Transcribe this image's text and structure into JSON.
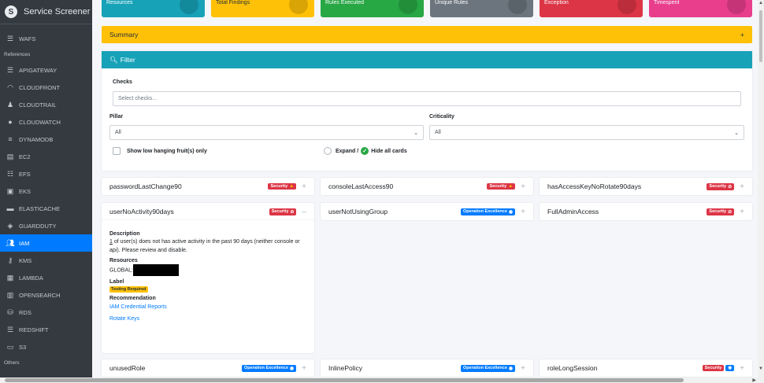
{
  "brand": {
    "name": "Service Screener"
  },
  "sidebar": {
    "top_items": [
      {
        "label": "WAFS",
        "icon": "list-icon"
      }
    ],
    "references_header": "References",
    "items": [
      {
        "label": "APIGATEWAY",
        "icon": "list-icon"
      },
      {
        "label": "CLOUDFRONT",
        "icon": "wifi-icon"
      },
      {
        "label": "CLOUDTRAIL",
        "icon": "user-secret-icon"
      },
      {
        "label": "CLOUDWATCH",
        "icon": "clock-icon"
      },
      {
        "label": "DYNAMODB",
        "icon": "bars-icon"
      },
      {
        "label": "EC2",
        "icon": "server-icon"
      },
      {
        "label": "EFS",
        "icon": "sitemap-icon"
      },
      {
        "label": "EKS",
        "icon": "briefcase-icon"
      },
      {
        "label": "ELASTICACHE",
        "icon": "memory-icon"
      },
      {
        "label": "GUARDDUTY",
        "icon": "shield-icon"
      },
      {
        "label": "IAM",
        "icon": "users-icon"
      },
      {
        "label": "KMS",
        "icon": "key-icon"
      },
      {
        "label": "LAMBDA",
        "icon": "calculator-icon"
      },
      {
        "label": "OPENSEARCH",
        "icon": "search-box-icon"
      },
      {
        "label": "RDS",
        "icon": "database-icon"
      },
      {
        "label": "REDSHIFT",
        "icon": "list-icon"
      },
      {
        "label": "S3",
        "icon": "hdd-icon"
      }
    ],
    "others_header": "Others",
    "active": "IAM"
  },
  "tiles": [
    {
      "label": "Resources",
      "color": "#17a2b8"
    },
    {
      "label": "Total Findings",
      "color": "#ffc107"
    },
    {
      "label": "Rules Executed",
      "color": "#28a745"
    },
    {
      "label": "Unique Rules",
      "color": "#6c757d"
    },
    {
      "label": "Exception",
      "color": "#dc3545"
    },
    {
      "label": "Timespent",
      "color": "#e83e8c"
    }
  ],
  "summary": {
    "title": "Summary",
    "toggle": "+"
  },
  "filter": {
    "title": "Filter",
    "checks_label": "Checks",
    "checks_placeholder": "Select checks...",
    "pillar_label": "Pillar",
    "pillar_value": "All",
    "criticality_label": "Criticality",
    "criticality_value": "All",
    "low_hanging_label": "Show low hanging fruit(s) only",
    "expand_label": "Expand /",
    "hide_label": "Hide all cards"
  },
  "cards": [
    {
      "name": "passwordLastChange90",
      "badge": "Security",
      "badge_type": "sec",
      "badge_icon": "warning-icon",
      "toggle": "+"
    },
    {
      "name": "consoleLastAccess90",
      "badge": "Security",
      "badge_type": "sec",
      "badge_icon": "warning-icon",
      "toggle": "+"
    },
    {
      "name": "hasAccessKeyNoRotate90days",
      "badge": "Security",
      "badge_type": "sec",
      "badge_icon": "ban-icon",
      "toggle": "+"
    },
    {
      "name": "userNoActivity90days",
      "badge": "Security",
      "badge_type": "sec",
      "badge_icon": "ban-icon",
      "toggle": "–"
    },
    {
      "name": "userNotUsingGroup",
      "badge": "Operation Excellence",
      "badge_type": "ops",
      "badge_icon": "eye-icon",
      "toggle": "+"
    },
    {
      "name": "FullAdminAccess",
      "badge": "Security",
      "badge_type": "sec",
      "badge_icon": "ban-icon",
      "toggle": "+"
    },
    {
      "name": "unusedRole",
      "badge": "Operation Excellence",
      "badge_type": "ops",
      "badge_icon": "eye-icon",
      "toggle": "+"
    },
    {
      "name": "InlinePolicy",
      "badge": "Operation Excellence",
      "badge_type": "ops",
      "badge_icon": "eye-icon",
      "toggle": "+"
    },
    {
      "name": "roleLongSession",
      "badge": "Security",
      "badge_type": "sec",
      "badge_icon": "eye-icon",
      "toggle": "+"
    }
  ],
  "detail": {
    "description_label": "Description",
    "description_count": "1",
    "description_text": " of user(s) does not has active activity in the past 90 days (neither console or api). Please review and disable.",
    "resources_label": "Resources",
    "resource_prefix": "GLOBAL:",
    "label_label": "Label",
    "label_tag": "Testing Required",
    "recommendation_label": "Recommendation",
    "links": [
      "IAM Credential Reports",
      "Rotate Keys"
    ]
  },
  "colors": {
    "sidebar_bg": "#343a40",
    "active": "#007bff",
    "summary": "#ffc107",
    "filter": "#17a2b8",
    "security": "#dc3545",
    "ops": "#007bff"
  }
}
